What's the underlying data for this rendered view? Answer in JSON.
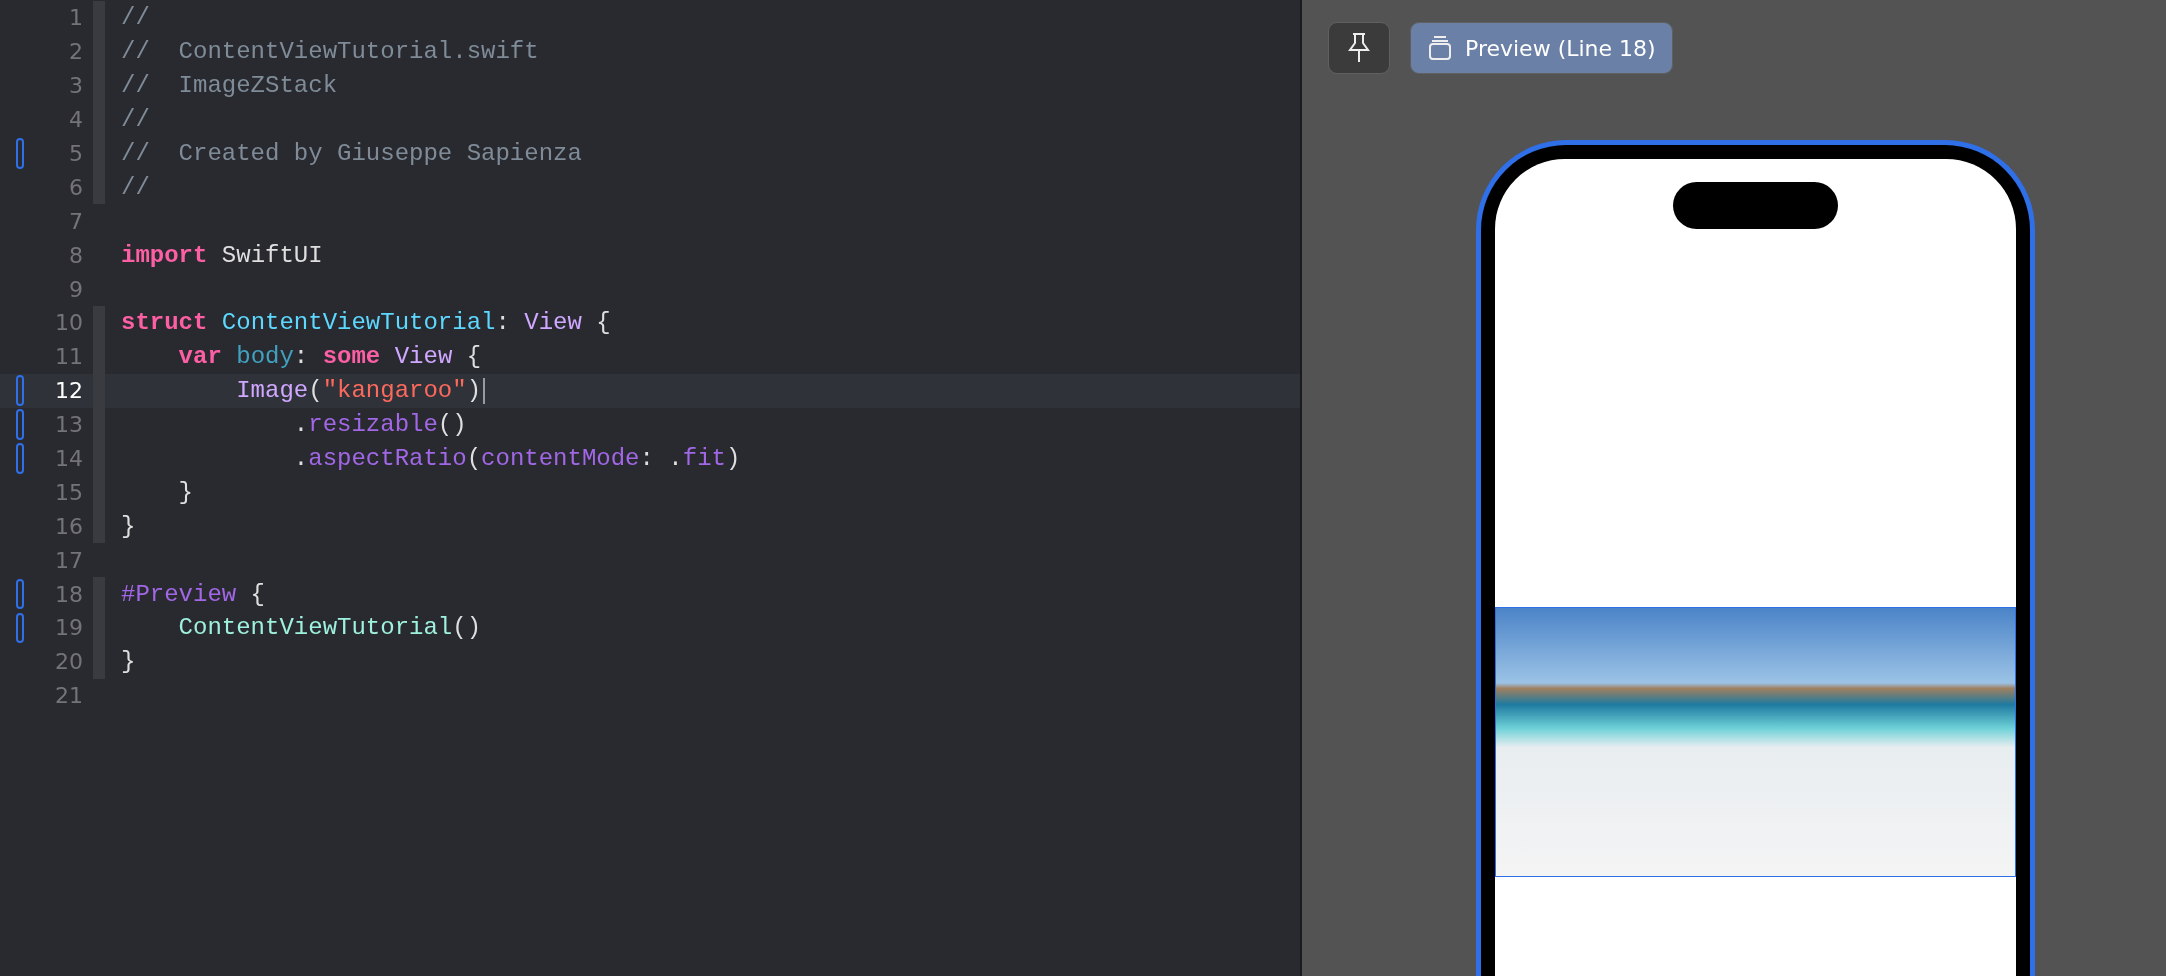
{
  "editor": {
    "lines": [
      {
        "number": "1",
        "changed": false,
        "current": false,
        "fold": true,
        "tokens": [
          {
            "text": "//",
            "kind": "comment"
          }
        ]
      },
      {
        "number": "2",
        "changed": false,
        "current": false,
        "fold": true,
        "tokens": [
          {
            "text": "//  ContentViewTutorial.swift",
            "kind": "comment"
          }
        ]
      },
      {
        "number": "3",
        "changed": false,
        "current": false,
        "fold": true,
        "tokens": [
          {
            "text": "//  ImageZStack",
            "kind": "comment"
          }
        ]
      },
      {
        "number": "4",
        "changed": false,
        "current": false,
        "fold": true,
        "tokens": [
          {
            "text": "//",
            "kind": "comment"
          }
        ]
      },
      {
        "number": "5",
        "changed": true,
        "current": false,
        "fold": true,
        "tokens": [
          {
            "text": "//  Created by Giuseppe Sapienza",
            "kind": "comment"
          }
        ]
      },
      {
        "number": "6",
        "changed": false,
        "current": false,
        "fold": true,
        "tokens": [
          {
            "text": "//",
            "kind": "comment"
          }
        ]
      },
      {
        "number": "7",
        "changed": false,
        "current": false,
        "fold": false
      },
      {
        "number": "8",
        "changed": false,
        "current": false,
        "fold": false,
        "tokens": [
          {
            "text": "import",
            "kind": "keyword"
          },
          {
            "text": " SwiftUI",
            "kind": "plain"
          }
        ]
      },
      {
        "number": "9",
        "changed": false,
        "current": false,
        "fold": false
      },
      {
        "number": "10",
        "changed": false,
        "current": false,
        "fold": true,
        "tokens": [
          {
            "text": "struct",
            "kind": "keyword"
          },
          {
            "text": " ContentViewTutorial",
            "kind": "declared-type"
          },
          {
            "text": ": ",
            "kind": "plain"
          },
          {
            "text": "View",
            "kind": "system-type"
          },
          {
            "text": " {",
            "kind": "plain"
          }
        ]
      },
      {
        "number": "11",
        "changed": false,
        "current": false,
        "fold": true,
        "tokens": [
          {
            "text": "    var",
            "kind": "keyword"
          },
          {
            "text": " body",
            "kind": "declaration"
          },
          {
            "text": ": ",
            "kind": "plain"
          },
          {
            "text": "some",
            "kind": "keyword"
          },
          {
            "text": " View",
            "kind": "system-type"
          },
          {
            "text": " {",
            "kind": "plain"
          }
        ]
      },
      {
        "number": "12",
        "changed": true,
        "current": true,
        "fold": true,
        "tokens": [
          {
            "text": "        Image",
            "kind": "system-type"
          },
          {
            "text": "(",
            "kind": "plain"
          },
          {
            "text": "\"kangaroo\"",
            "kind": "string"
          },
          {
            "text": ")",
            "kind": "plain"
          }
        ]
      },
      {
        "number": "13",
        "changed": true,
        "current": false,
        "fold": true,
        "tokens": [
          {
            "text": "            .",
            "kind": "plain"
          },
          {
            "text": "resizable",
            "kind": "member"
          },
          {
            "text": "()",
            "kind": "plain"
          }
        ]
      },
      {
        "number": "14",
        "changed": true,
        "current": false,
        "fold": true,
        "tokens": [
          {
            "text": "            .",
            "kind": "plain"
          },
          {
            "text": "aspectRatio",
            "kind": "member"
          },
          {
            "text": "(",
            "kind": "plain"
          },
          {
            "text": "contentMode",
            "kind": "member"
          },
          {
            "text": ": .",
            "kind": "plain"
          },
          {
            "text": "fit",
            "kind": "member"
          },
          {
            "text": ")",
            "kind": "plain"
          }
        ]
      },
      {
        "number": "15",
        "changed": false,
        "current": false,
        "fold": true,
        "tokens": [
          {
            "text": "    }",
            "kind": "plain"
          }
        ]
      },
      {
        "number": "16",
        "changed": false,
        "current": false,
        "fold": true,
        "tokens": [
          {
            "text": "}",
            "kind": "plain"
          }
        ]
      },
      {
        "number": "17",
        "changed": false,
        "current": false,
        "fold": false
      },
      {
        "number": "18",
        "changed": true,
        "current": false,
        "fold": true,
        "tokens": [
          {
            "text": "#Preview",
            "kind": "member"
          },
          {
            "text": " {",
            "kind": "plain"
          }
        ]
      },
      {
        "number": "19",
        "changed": true,
        "current": false,
        "fold": true,
        "tokens": [
          {
            "text": "    ContentViewTutorial",
            "kind": "project-call"
          },
          {
            "text": "()",
            "kind": "plain"
          }
        ]
      },
      {
        "number": "20",
        "changed": false,
        "current": false,
        "fold": true,
        "tokens": [
          {
            "text": "}",
            "kind": "plain"
          }
        ]
      },
      {
        "number": "21",
        "changed": false,
        "current": false,
        "fold": false
      }
    ]
  },
  "preview": {
    "pin_selected": false,
    "preview_button": {
      "label": "Preview (Line 18)",
      "selected": true
    }
  }
}
